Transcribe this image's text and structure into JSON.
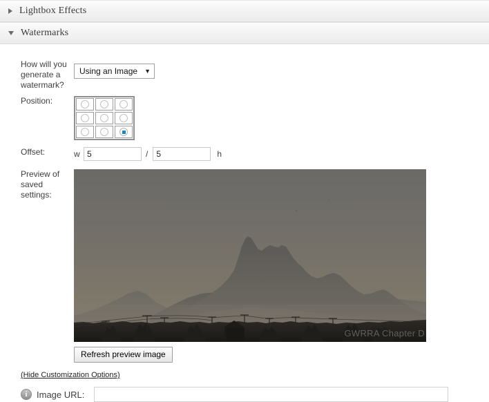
{
  "panels": [
    {
      "title": "Lightbox Effects",
      "expanded": false,
      "arrow_icon": "chevron-right-icon"
    },
    {
      "title": "Watermarks",
      "expanded": true,
      "arrow_icon": "chevron-down-icon"
    }
  ],
  "watermarks": {
    "generate": {
      "label": "How will you generate a watermark?",
      "selected_option": "Using an Image",
      "caret": "▼"
    },
    "position": {
      "label": "Position:",
      "cells": [
        {
          "name": "top-left",
          "selected": false
        },
        {
          "name": "top-center",
          "selected": false
        },
        {
          "name": "top-right",
          "selected": false
        },
        {
          "name": "middle-left",
          "selected": false
        },
        {
          "name": "middle-center",
          "selected": false
        },
        {
          "name": "middle-right",
          "selected": false
        },
        {
          "name": "bottom-left",
          "selected": false
        },
        {
          "name": "bottom-center",
          "selected": false
        },
        {
          "name": "bottom-right",
          "selected": true
        }
      ],
      "selected_index": 8,
      "selected_color": "#1a87c4"
    },
    "offset": {
      "label": "Offset:",
      "width_tag": "w",
      "width_value": "5",
      "separator": "/",
      "height_value": "5",
      "height_tag": "h"
    },
    "preview": {
      "label": "Preview of saved settings:",
      "watermark_text": "GWRRA Chapter D",
      "sky_top_color": "#6e6c68",
      "sky_bottom_color": "#7b7468",
      "mountain_color": "#5f5d5a",
      "foreground_color": "#24211e"
    },
    "refresh_button": "Refresh preview image",
    "customization_link": "(Hide Customization Options)",
    "image_url": {
      "info_icon_glyph": "i",
      "label": "Image URL:",
      "value": "",
      "placeholder": ""
    }
  }
}
